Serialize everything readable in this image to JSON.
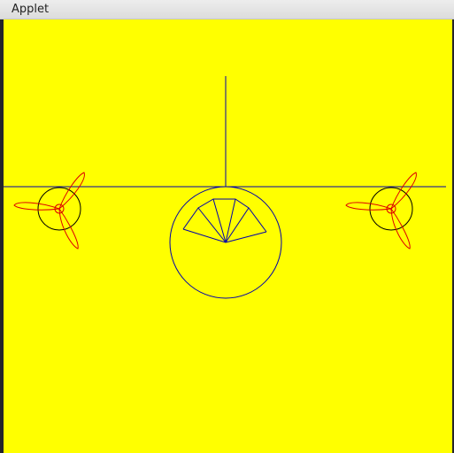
{
  "window": {
    "title": "Applet"
  },
  "colors": {
    "canvas_background": "#ffff00",
    "airframe_stroke": "#0000aa",
    "engine_stroke": "#000000",
    "propeller_stroke": "#dd0000"
  },
  "icons": {
    "applet_drawing": "airplane-front-view"
  }
}
